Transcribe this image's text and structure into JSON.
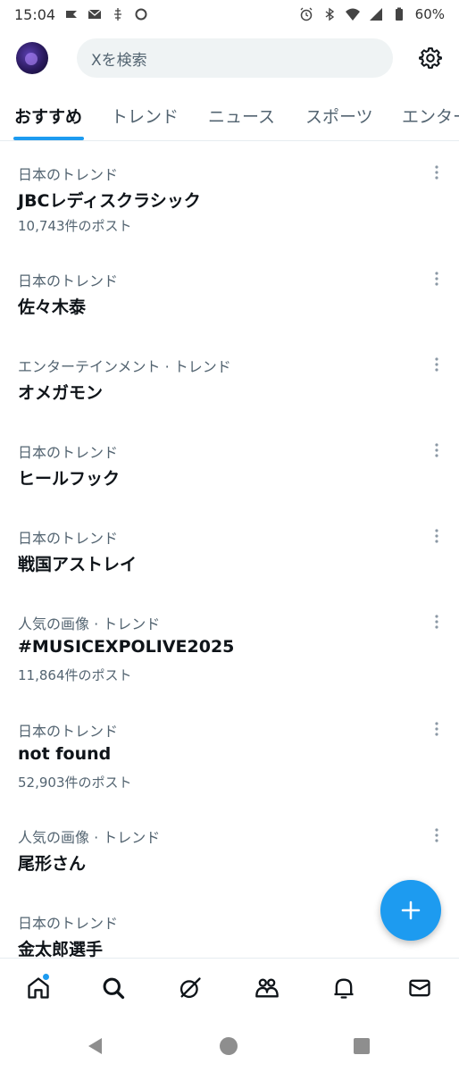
{
  "status_bar": {
    "time": "15:04",
    "battery": "60%",
    "icons": [
      "app-icon",
      "mail-icon",
      "notification-icon",
      "circle-icon",
      "alarm-icon",
      "bluetooth-icon",
      "wifi-icon",
      "signal-icon",
      "battery-icon"
    ]
  },
  "header": {
    "search_placeholder": "Xを検索"
  },
  "tabs": [
    {
      "label": "おすすめ",
      "active": true
    },
    {
      "label": "トレンド",
      "active": false
    },
    {
      "label": "ニュース",
      "active": false
    },
    {
      "label": "スポーツ",
      "active": false
    },
    {
      "label": "エンター",
      "active": false
    }
  ],
  "trends": [
    {
      "context": "日本のトレンド",
      "title": "JBCレディスクラシック",
      "count": "10,743件のポスト"
    },
    {
      "context": "日本のトレンド",
      "title": "佐々木泰",
      "count": ""
    },
    {
      "context": "エンターテインメント · トレンド",
      "title": "オメガモン",
      "count": ""
    },
    {
      "context": "日本のトレンド",
      "title": "ヒールフック",
      "count": ""
    },
    {
      "context": "日本のトレンド",
      "title": "戦国アストレイ",
      "count": ""
    },
    {
      "context": "人気の画像 · トレンド",
      "title": "#MUSICEXPOLIVE2025",
      "count": "11,864件のポスト"
    },
    {
      "context": "日本のトレンド",
      "title": "not found",
      "count": "52,903件のポスト"
    },
    {
      "context": "人気の画像 · トレンド",
      "title": "尾形さん",
      "count": ""
    },
    {
      "context": "日本のトレンド",
      "title": "金太郎選手",
      "count": ""
    }
  ],
  "bottom_nav": [
    "home-icon",
    "search-icon",
    "grok-icon",
    "communities-icon",
    "notifications-icon",
    "messages-icon"
  ],
  "colors": {
    "accent": "#1d9bf0",
    "text_primary": "#0f1419",
    "text_secondary": "#536471",
    "search_bg": "#eff3f4"
  }
}
